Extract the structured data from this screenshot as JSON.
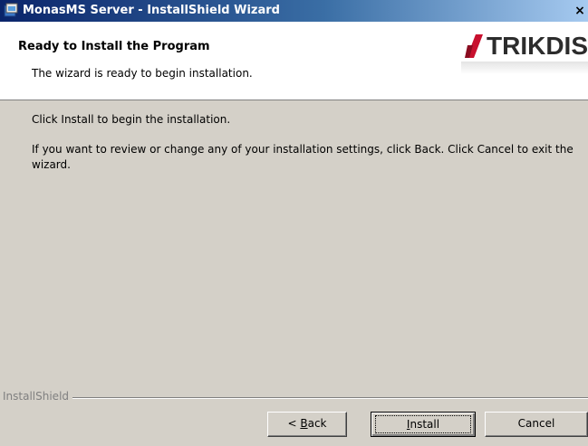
{
  "window": {
    "title": "MonasMS Server - InstallShield Wizard",
    "close_label": "×"
  },
  "header": {
    "title": "Ready to Install the Program",
    "subtitle": "The wizard is ready to begin installation.",
    "logo_text": "TRIKDIS",
    "logo_color": "#c8102e"
  },
  "body": {
    "line1": "Click Install to begin the installation.",
    "line2": "If you want to review or change any of your installation settings, click Back. Click Cancel to exit the wizard."
  },
  "footer": {
    "brand": "InstallShield"
  },
  "buttons": {
    "back": {
      "prefix": "< ",
      "mnemonic": "B",
      "rest": "ack"
    },
    "install": {
      "mnemonic": "I",
      "rest": "nstall"
    },
    "cancel": "Cancel"
  }
}
